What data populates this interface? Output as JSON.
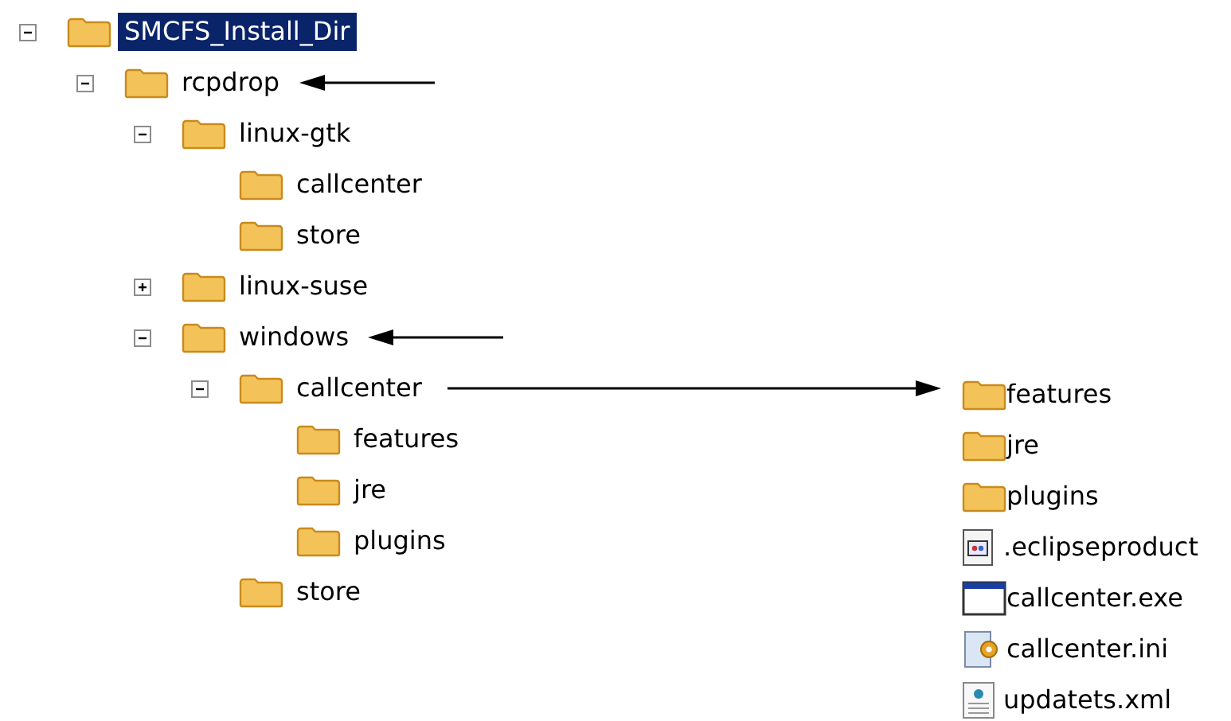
{
  "tree": [
    {
      "label": "SMCFS_Install_Dir",
      "selected": true,
      "expanded": true,
      "children": [
        {
          "label": "rcpdrop",
          "selected": false,
          "expanded": true,
          "annotation": {
            "kind": "left"
          },
          "children": [
            {
              "label": "linux-gtk",
              "selected": false,
              "expanded": true,
              "children": [
                {
                  "label": "callcenter",
                  "selected": false
                },
                {
                  "label": "store",
                  "selected": false
                }
              ]
            },
            {
              "label": "linux-suse",
              "selected": false,
              "expanded": false
            },
            {
              "label": "windows",
              "selected": false,
              "expanded": true,
              "annotation": {
                "kind": "left"
              },
              "children": [
                {
                  "label": "callcenter",
                  "selected": false,
                  "expanded": true,
                  "annotation": {
                    "kind": "right"
                  },
                  "children": [
                    {
                      "label": "features",
                      "selected": false
                    },
                    {
                      "label": "jre",
                      "selected": false
                    },
                    {
                      "label": "plugins",
                      "selected": false
                    }
                  ]
                },
                {
                  "label": "store",
                  "selected": false
                }
              ]
            }
          ]
        }
      ]
    }
  ],
  "contents": [
    {
      "name": "features",
      "kind": "folder"
    },
    {
      "name": "jre",
      "kind": "folder"
    },
    {
      "name": "plugins",
      "kind": "folder"
    },
    {
      "name": ".eclipseproduct",
      "kind": "product"
    },
    {
      "name": "callcenter.exe",
      "kind": "exe"
    },
    {
      "name": "callcenter.ini",
      "kind": "config"
    },
    {
      "name": "updatets.xml",
      "kind": "xml"
    }
  ]
}
